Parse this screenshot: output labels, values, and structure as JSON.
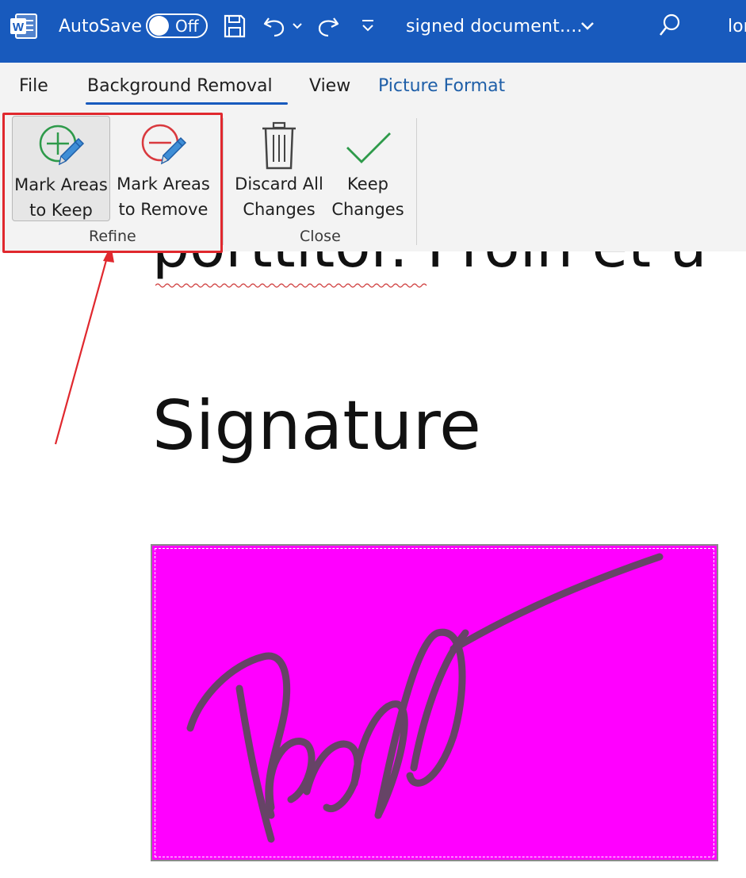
{
  "titlebar": {
    "app_letter": "W",
    "autosave_label": "AutoSave",
    "autosave_state": "Off",
    "document_title": "signed document....",
    "user_fragment": "lor"
  },
  "tabs": {
    "file": "File",
    "background_removal": "Background Removal",
    "view": "View",
    "picture_format": "Picture Format"
  },
  "ribbon": {
    "refine": {
      "group_label": "Refine",
      "mark_keep": [
        "Mark Areas",
        "to Keep"
      ],
      "mark_remove": [
        "Mark Areas",
        "to Remove"
      ]
    },
    "close": {
      "group_label": "Close",
      "discard": [
        "Discard All",
        "Changes"
      ],
      "keep": [
        "Keep",
        "Changes"
      ]
    }
  },
  "document": {
    "partial_line": "porttitor. Proin et u",
    "heading": "Signature"
  },
  "colors": {
    "titlebar": "#185abd",
    "highlight": "#e0282e",
    "removal_overlay": "#ff00ff",
    "keep_icon": "#2e9a4a",
    "remove_icon": "#d9393e"
  }
}
